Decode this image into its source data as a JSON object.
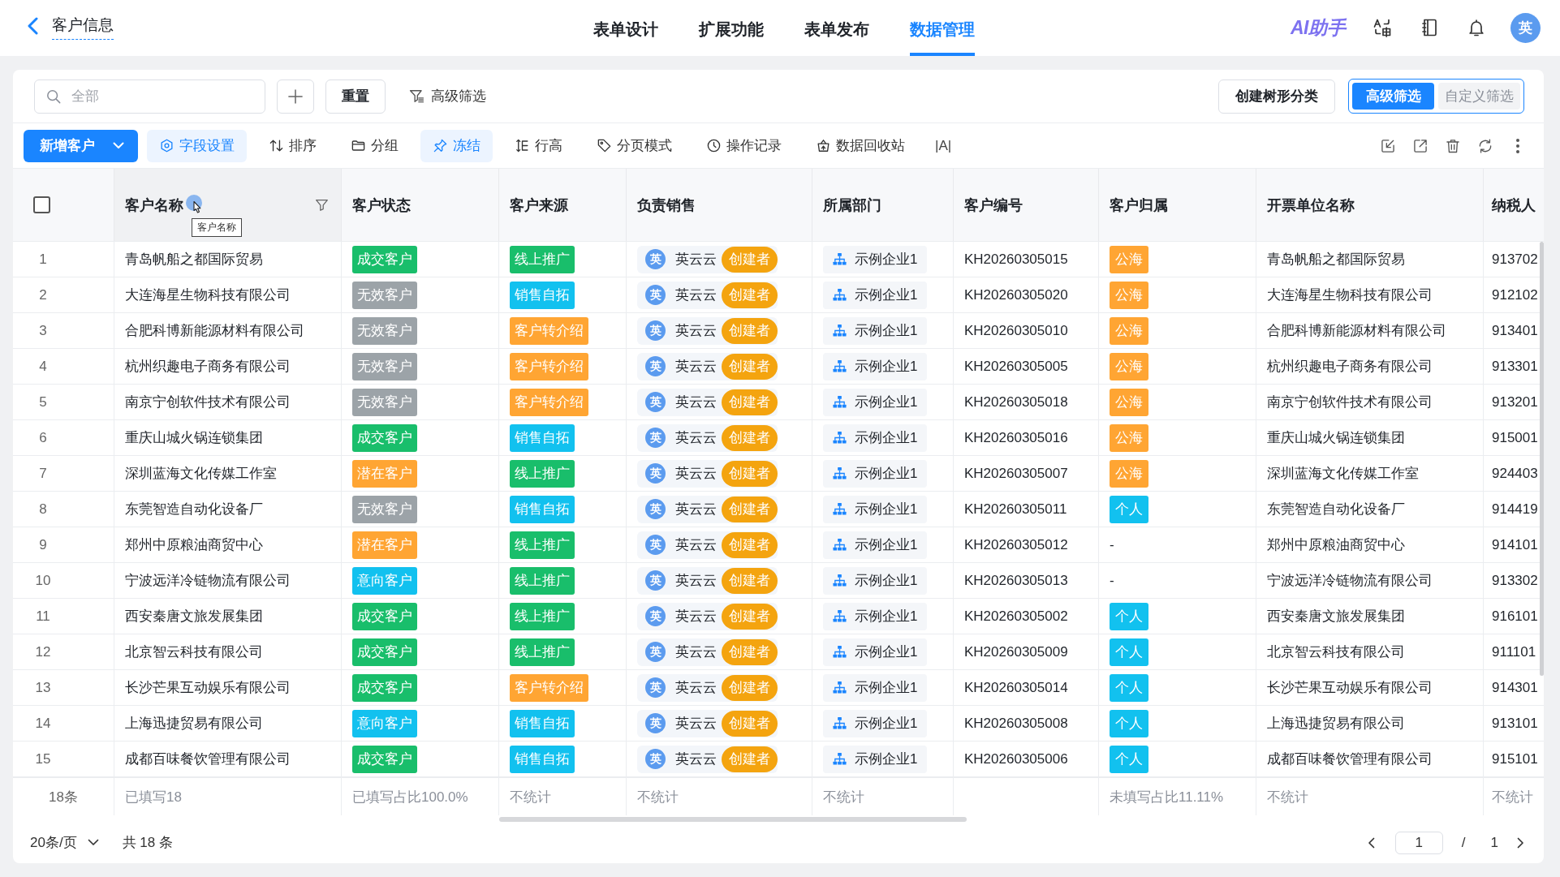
{
  "header": {
    "title": "客户信息",
    "tabs": [
      {
        "label": "表单设计",
        "selected": false
      },
      {
        "label": "扩展功能",
        "selected": false
      },
      {
        "label": "表单发布",
        "selected": false
      },
      {
        "label": "数据管理",
        "selected": true
      }
    ],
    "ai_assistant": "AI助手",
    "avatar": "英"
  },
  "filter_bar": {
    "search": {
      "placeholder": "全部"
    },
    "reset": "重置",
    "advanced_filter": "高级筛选",
    "create_tree": "创建树形分类",
    "filter_modes": [
      {
        "label": "高级筛选",
        "selected": true
      },
      {
        "label": "自定义筛选",
        "selected": false
      }
    ]
  },
  "toolbar": {
    "add_button": "新增客户",
    "tools": [
      {
        "label": "字段设置",
        "active": true
      },
      {
        "label": "排序",
        "active": false
      },
      {
        "label": "分组",
        "active": false
      },
      {
        "label": "冻结",
        "active": true
      },
      {
        "label": "行高",
        "active": false
      },
      {
        "label": "分页模式",
        "active": false
      },
      {
        "label": "操作记录",
        "active": false
      },
      {
        "label": "数据回收站",
        "active": false
      }
    ],
    "text_tool": "|A|"
  },
  "table": {
    "select_all_checked": false,
    "count_summary": "18条",
    "tooltip": "客户名称",
    "columns": [
      {
        "label": "客户名称",
        "hovered": true,
        "summary": "已填写18"
      },
      {
        "label": "客户状态",
        "hovered": false,
        "summary": "已填写占比100.0%"
      },
      {
        "label": "客户来源",
        "hovered": false,
        "summary": "不统计"
      },
      {
        "label": "负责销售",
        "hovered": false,
        "summary": "不统计"
      },
      {
        "label": "所属部门",
        "hovered": false,
        "summary": "不统计"
      },
      {
        "label": "客户编号",
        "hovered": false
      },
      {
        "label": "客户归属",
        "hovered": false,
        "summary": "未填写占比11.11%"
      },
      {
        "label": "开票单位名称",
        "hovered": false,
        "summary": "不统计"
      },
      {
        "label": "纳税人",
        "hovered": false,
        "summary": "不统计"
      }
    ],
    "rows": [
      {
        "index": "1",
        "name": "青岛帆船之都国际贸易",
        "status": {
          "label": "成交客户",
          "color": "#19be6b"
        },
        "source": {
          "label": "线上推广",
          "color": "#19be6b"
        },
        "sales": {
          "avatar": "英",
          "name": "英云云",
          "role": "创建者"
        },
        "department": "示例企业1",
        "code": "KH20260305015",
        "ownership": {
          "label": "公海",
          "color": "#ffa533"
        },
        "invoice_name": "青岛帆船之都国际贸易",
        "taxpayer_id": "913702"
      },
      {
        "index": "2",
        "name": "大连海星生物科技有限公司",
        "status": {
          "label": "无效客户",
          "color": "#9ca3a8"
        },
        "source": {
          "label": "销售自拓",
          "color": "#12c1ef"
        },
        "sales": {
          "avatar": "英",
          "name": "英云云",
          "role": "创建者"
        },
        "department": "示例企业1",
        "code": "KH20260305020",
        "ownership": {
          "label": "公海",
          "color": "#ffa533"
        },
        "invoice_name": "大连海星生物科技有限公司",
        "taxpayer_id": "912102"
      },
      {
        "index": "3",
        "name": "合肥科博新能源材料有限公司",
        "status": {
          "label": "无效客户",
          "color": "#9ca3a8"
        },
        "source": {
          "label": "客户转介绍",
          "color": "#ffa533"
        },
        "sales": {
          "avatar": "英",
          "name": "英云云",
          "role": "创建者"
        },
        "department": "示例企业1",
        "code": "KH20260305010",
        "ownership": {
          "label": "公海",
          "color": "#ffa533"
        },
        "invoice_name": "合肥科博新能源材料有限公司",
        "taxpayer_id": "913401"
      },
      {
        "index": "4",
        "name": "杭州织趣电子商务有限公司",
        "status": {
          "label": "无效客户",
          "color": "#9ca3a8"
        },
        "source": {
          "label": "客户转介绍",
          "color": "#ffa533"
        },
        "sales": {
          "avatar": "英",
          "name": "英云云",
          "role": "创建者"
        },
        "department": "示例企业1",
        "code": "KH20260305005",
        "ownership": {
          "label": "公海",
          "color": "#ffa533"
        },
        "invoice_name": "杭州织趣电子商务有限公司",
        "taxpayer_id": "913301"
      },
      {
        "index": "5",
        "name": "南京宁创软件技术有限公司",
        "status": {
          "label": "无效客户",
          "color": "#9ca3a8"
        },
        "source": {
          "label": "客户转介绍",
          "color": "#ffa533"
        },
        "sales": {
          "avatar": "英",
          "name": "英云云",
          "role": "创建者"
        },
        "department": "示例企业1",
        "code": "KH20260305018",
        "ownership": {
          "label": "公海",
          "color": "#ffa533"
        },
        "invoice_name": "南京宁创软件技术有限公司",
        "taxpayer_id": "913201"
      },
      {
        "index": "6",
        "name": "重庆山城火锅连锁集团",
        "status": {
          "label": "成交客户",
          "color": "#19be6b"
        },
        "source": {
          "label": "销售自拓",
          "color": "#12c1ef"
        },
        "sales": {
          "avatar": "英",
          "name": "英云云",
          "role": "创建者"
        },
        "department": "示例企业1",
        "code": "KH20260305016",
        "ownership": {
          "label": "公海",
          "color": "#ffa533"
        },
        "invoice_name": "重庆山城火锅连锁集团",
        "taxpayer_id": "915001"
      },
      {
        "index": "7",
        "name": "深圳蓝海文化传媒工作室",
        "status": {
          "label": "潜在客户",
          "color": "#ffa533"
        },
        "source": {
          "label": "线上推广",
          "color": "#19be6b"
        },
        "sales": {
          "avatar": "英",
          "name": "英云云",
          "role": "创建者"
        },
        "department": "示例企业1",
        "code": "KH20260305007",
        "ownership": {
          "label": "公海",
          "color": "#ffa533"
        },
        "invoice_name": "深圳蓝海文化传媒工作室",
        "taxpayer_id": "924403"
      },
      {
        "index": "8",
        "name": "东莞智造自动化设备厂",
        "status": {
          "label": "无效客户",
          "color": "#9ca3a8"
        },
        "source": {
          "label": "销售自拓",
          "color": "#12c1ef"
        },
        "sales": {
          "avatar": "英",
          "name": "英云云",
          "role": "创建者"
        },
        "department": "示例企业1",
        "code": "KH20260305011",
        "ownership": {
          "label": "个人",
          "color": "#12c1ef"
        },
        "invoice_name": "东莞智造自动化设备厂",
        "taxpayer_id": "914419"
      },
      {
        "index": "9",
        "name": "郑州中原粮油商贸中心",
        "status": {
          "label": "潜在客户",
          "color": "#ffa533"
        },
        "source": {
          "label": "线上推广",
          "color": "#19be6b"
        },
        "sales": {
          "avatar": "英",
          "name": "英云云",
          "role": "创建者"
        },
        "department": "示例企业1",
        "code": "KH20260305012",
        "ownership": {
          "label": "-"
        },
        "invoice_name": "郑州中原粮油商贸中心",
        "taxpayer_id": "914101"
      },
      {
        "index": "10",
        "name": "宁波远洋冷链物流有限公司",
        "status": {
          "label": "意向客户",
          "color": "#12c1ef"
        },
        "source": {
          "label": "线上推广",
          "color": "#19be6b"
        },
        "sales": {
          "avatar": "英",
          "name": "英云云",
          "role": "创建者"
        },
        "department": "示例企业1",
        "code": "KH20260305013",
        "ownership": {
          "label": "-"
        },
        "invoice_name": "宁波远洋冷链物流有限公司",
        "taxpayer_id": "913302"
      },
      {
        "index": "11",
        "name": "西安秦唐文旅发展集团",
        "status": {
          "label": "成交客户",
          "color": "#19be6b"
        },
        "source": {
          "label": "线上推广",
          "color": "#19be6b"
        },
        "sales": {
          "avatar": "英",
          "name": "英云云",
          "role": "创建者"
        },
        "department": "示例企业1",
        "code": "KH20260305002",
        "ownership": {
          "label": "个人",
          "color": "#12c1ef"
        },
        "invoice_name": "西安秦唐文旅发展集团",
        "taxpayer_id": "916101"
      },
      {
        "index": "12",
        "name": "北京智云科技有限公司",
        "status": {
          "label": "成交客户",
          "color": "#19be6b"
        },
        "source": {
          "label": "线上推广",
          "color": "#19be6b"
        },
        "sales": {
          "avatar": "英",
          "name": "英云云",
          "role": "创建者"
        },
        "department": "示例企业1",
        "code": "KH20260305009",
        "ownership": {
          "label": "个人",
          "color": "#12c1ef"
        },
        "invoice_name": "北京智云科技有限公司",
        "taxpayer_id": "911101"
      },
      {
        "index": "13",
        "name": "长沙芒果互动娱乐有限公司",
        "status": {
          "label": "成交客户",
          "color": "#19be6b"
        },
        "source": {
          "label": "客户转介绍",
          "color": "#ffa533"
        },
        "sales": {
          "avatar": "英",
          "name": "英云云",
          "role": "创建者"
        },
        "department": "示例企业1",
        "code": "KH20260305014",
        "ownership": {
          "label": "个人",
          "color": "#12c1ef"
        },
        "invoice_name": "长沙芒果互动娱乐有限公司",
        "taxpayer_id": "914301"
      },
      {
        "index": "14",
        "name": "上海迅捷贸易有限公司",
        "status": {
          "label": "意向客户",
          "color": "#12c1ef"
        },
        "source": {
          "label": "销售自拓",
          "color": "#12c1ef"
        },
        "sales": {
          "avatar": "英",
          "name": "英云云",
          "role": "创建者"
        },
        "department": "示例企业1",
        "code": "KH20260305008",
        "ownership": {
          "label": "个人",
          "color": "#12c1ef"
        },
        "invoice_name": "上海迅捷贸易有限公司",
        "taxpayer_id": "913101"
      },
      {
        "index": "15",
        "name": "成都百味餐饮管理有限公司",
        "status": {
          "label": "成交客户",
          "color": "#19be6b"
        },
        "source": {
          "label": "销售自拓",
          "color": "#12c1ef"
        },
        "sales": {
          "avatar": "英",
          "name": "英云云",
          "role": "创建者"
        },
        "department": "示例企业1",
        "code": "KH20260305006",
        "ownership": {
          "label": "个人",
          "color": "#12c1ef"
        },
        "invoice_name": "成都百味餐饮管理有限公司",
        "taxpayer_id": "915101"
      }
    ]
  },
  "pagination": {
    "page_size": "20条/页",
    "total": "共 18 条",
    "page": "1",
    "separator": "/",
    "page_count": "1"
  }
}
